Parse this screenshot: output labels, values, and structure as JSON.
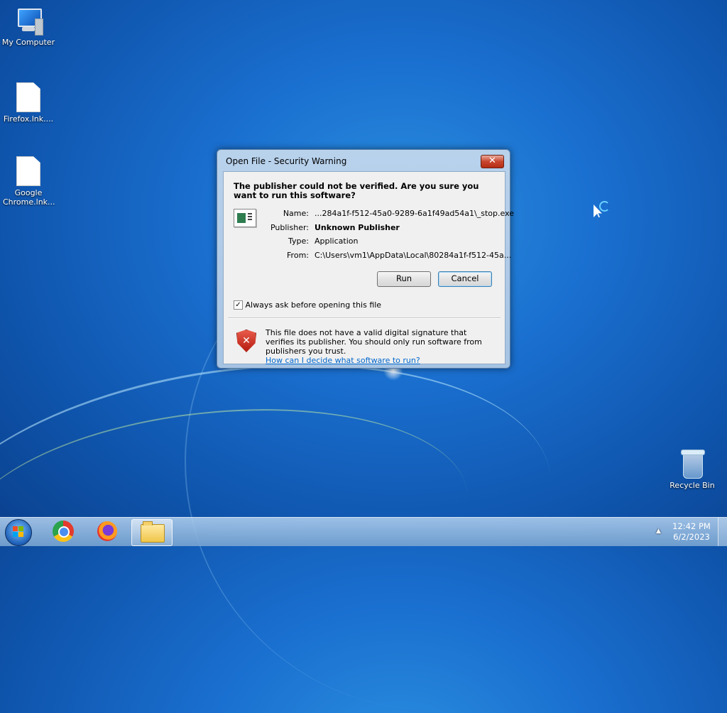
{
  "desktop": {
    "icons": [
      {
        "label": "My Computer"
      },
      {
        "label": "Firefox.lnk...."
      },
      {
        "label": "Google Chrome.lnk..."
      },
      {
        "label": "Recycle Bin"
      }
    ]
  },
  "dialog": {
    "title": "Open File - Security Warning",
    "close_label": "✕",
    "headline": "The publisher could not be verified.  Are you sure you want to run this software?",
    "fields": [
      {
        "label": "Name:",
        "value": "...284a1f-f512-45a0-9289-6a1f49ad54a1\\_stop.exe"
      },
      {
        "label": "Publisher:",
        "value": "Unknown Publisher"
      },
      {
        "label": "Type:",
        "value": "Application"
      },
      {
        "label": "From:",
        "value": "C:\\Users\\vm1\\AppData\\Local\\80284a1f-f512-45a..."
      }
    ],
    "run_label": "Run",
    "cancel_label": "Cancel",
    "checkbox_label": "Always ask before opening this file",
    "checkbox_checked": true,
    "warning_text": "This file does not have a valid digital signature that verifies its publisher.  You should only run software from publishers you trust.",
    "help_link": "How can I decide what software to run?"
  },
  "taskbar": {
    "apps": [
      {
        "icon": "chrome-icon"
      },
      {
        "icon": "firefox-icon"
      },
      {
        "icon": "file-explorer-icon"
      }
    ],
    "tray_arrow": "▲",
    "time": "12:42 PM",
    "date": "6/2/2023"
  }
}
